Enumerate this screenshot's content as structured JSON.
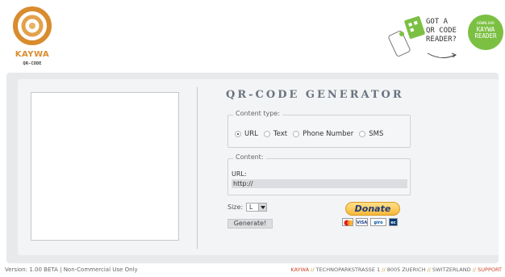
{
  "logo": {
    "name": "KAYWA",
    "sub": "QR-CODE"
  },
  "promo": {
    "text": "GOT A\nQR CODE\nREADER?",
    "download_small": "DOWNLOAD",
    "download_big": "KAYWA\nREADER"
  },
  "form": {
    "title": "QR-CODE GENERATOR",
    "content_type_legend": "Content type:",
    "radio_options": [
      "URL",
      "Text",
      "Phone Number",
      "SMS"
    ],
    "selected_option": "URL",
    "content_legend": "Content:",
    "url_label": "URL:",
    "url_value": "http://",
    "size_label": "Size:",
    "size_value": "L",
    "generate_label": "Generate!",
    "donate_label": "Donate"
  },
  "footer": {
    "version": "Version: 1.00 BETA | Non-Commercial Use Only",
    "company": "KAYWA",
    "sep": " // ",
    "street": "TECHNOPARKSTRASSE 1",
    "city": "8005 ZUERICH",
    "country": "SWITZERLAND",
    "support": "SUPPORT"
  },
  "colors": {
    "accent_orange": "#d98c2e",
    "green": "#7cc043",
    "title_grey": "#6a7380",
    "footer_accent": "#d0452a"
  },
  "icons": [
    "kaywa-logo-icon",
    "phone-scanner-icon",
    "mastercard-icon",
    "visa-icon",
    "giropay-icon",
    "ec-card-icon"
  ]
}
